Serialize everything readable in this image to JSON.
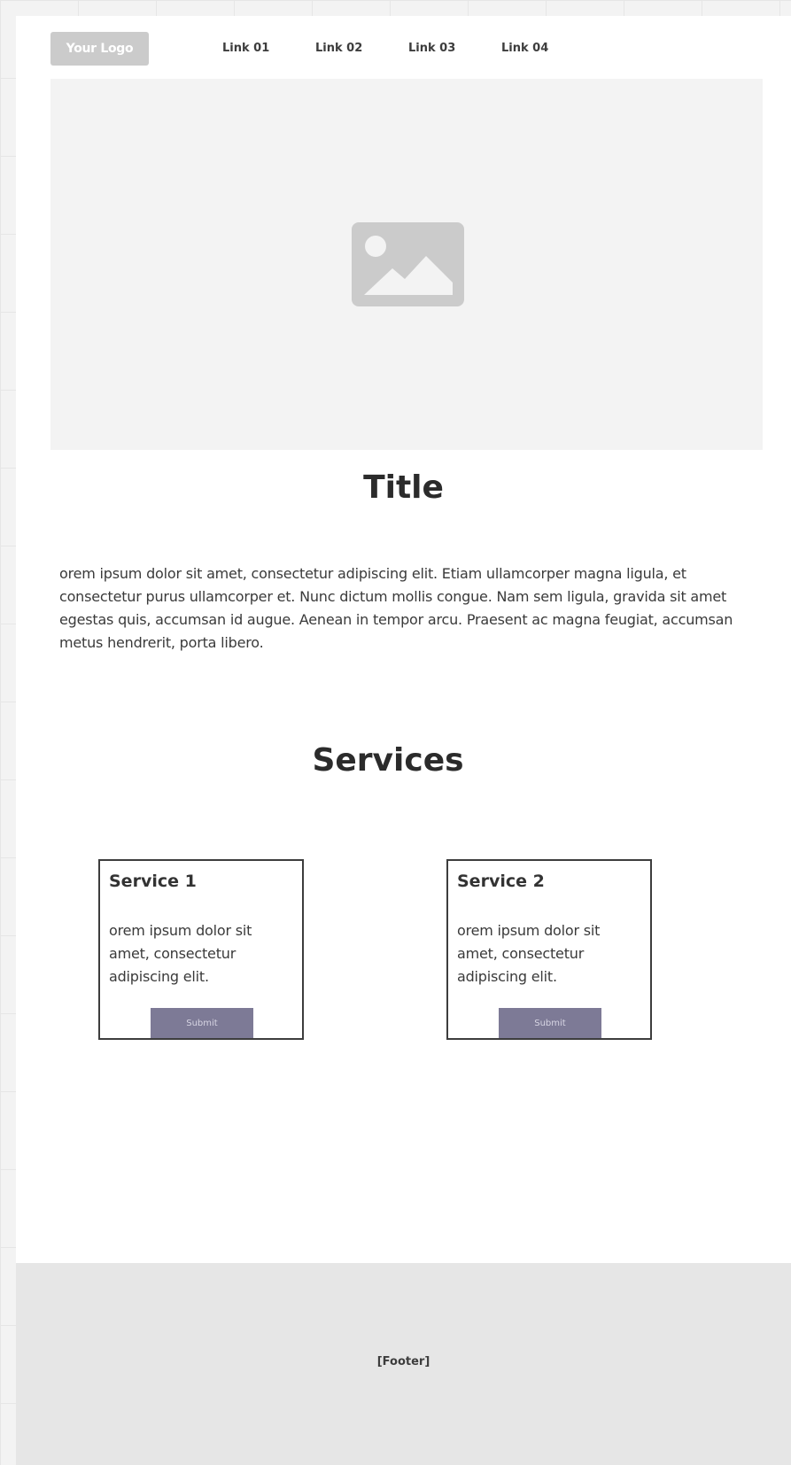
{
  "header": {
    "logo_text": "Your Logo",
    "nav_links": [
      "Link 01",
      "Link 02",
      "Link 03",
      "Link 04"
    ]
  },
  "hero": {
    "image_icon": "image-placeholder-icon"
  },
  "main": {
    "title": "Title",
    "intro_text": "orem ipsum dolor sit amet, consectetur adipiscing elit. Etiam ullamcorper magna ligula, et consectetur purus ullamcorper et. Nunc dictum mollis congue. Nam sem ligula, gravida sit amet egestas quis, accumsan id augue. Aenean in tempor arcu. Praesent ac magna feugiat, accumsan metus hendrerit, porta libero."
  },
  "services": {
    "title": "Services",
    "cards": [
      {
        "title": "Service 1",
        "text": "orem ipsum dolor sit amet, consectetur adipiscing elit.",
        "button_label": "Submit"
      },
      {
        "title": "Service 2",
        "text": "orem ipsum dolor sit amet, consectetur adipiscing elit.",
        "button_label": "Submit"
      }
    ]
  },
  "footer": {
    "text": "[Footer]"
  },
  "colors": {
    "logo_bg": "#cbcbcb",
    "hero_bg": "#f3f3f3",
    "button_bg": "#7d7a96",
    "footer_bg": "#e6e6e6"
  }
}
